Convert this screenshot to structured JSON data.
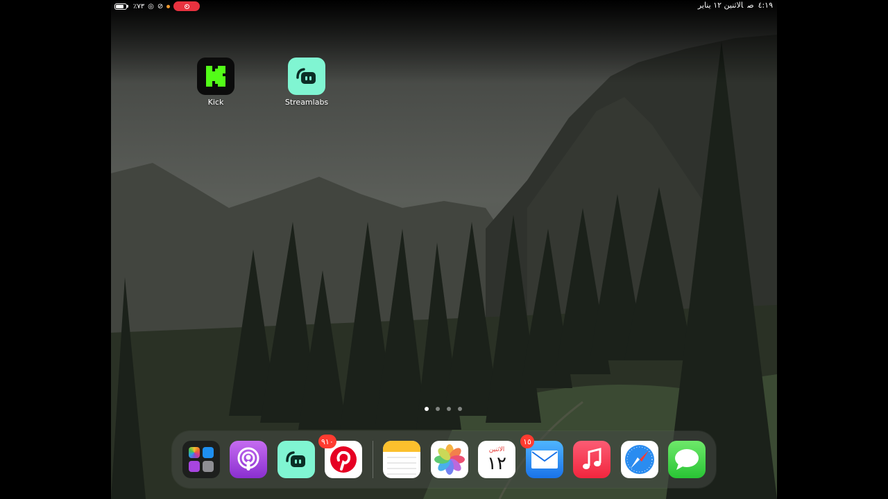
{
  "status_bar": {
    "battery_percent": "٪٧٣",
    "time": "٤:١٩",
    "ampm": "ص",
    "date": "الاثنين ١٢ يناير",
    "recording": true
  },
  "home_apps": [
    {
      "label": "Kick",
      "icon": "kick-icon"
    },
    {
      "label": "Streamlabs",
      "icon": "streamlabs-icon"
    }
  ],
  "page_indicator": {
    "pages": 4,
    "current": 1
  },
  "dock": {
    "apps": [
      {
        "name": "app-library-folder",
        "icon": "app-library-icon"
      },
      {
        "name": "podcasts",
        "icon": "podcasts-icon"
      },
      {
        "name": "streamlabs",
        "icon": "streamlabs-icon"
      },
      {
        "name": "pinterest",
        "icon": "pinterest-icon",
        "badge": "٩١٠"
      },
      {
        "name": "notes",
        "icon": "notes-icon"
      },
      {
        "name": "photos",
        "icon": "photos-icon"
      },
      {
        "name": "calendar",
        "icon": "calendar-icon",
        "day_name": "الاثنين",
        "day_number": "١٢"
      },
      {
        "name": "mail",
        "icon": "mail-icon",
        "badge": "١٥"
      },
      {
        "name": "music",
        "icon": "music-icon"
      },
      {
        "name": "safari",
        "icon": "safari-icon"
      },
      {
        "name": "messages",
        "icon": "messages-icon"
      }
    ]
  },
  "colors": {
    "kick_green": "#53fc18",
    "streamlabs_mint": "#80f5d2",
    "badge_red": "#ff3b30",
    "recording_red": "#e8323f"
  }
}
